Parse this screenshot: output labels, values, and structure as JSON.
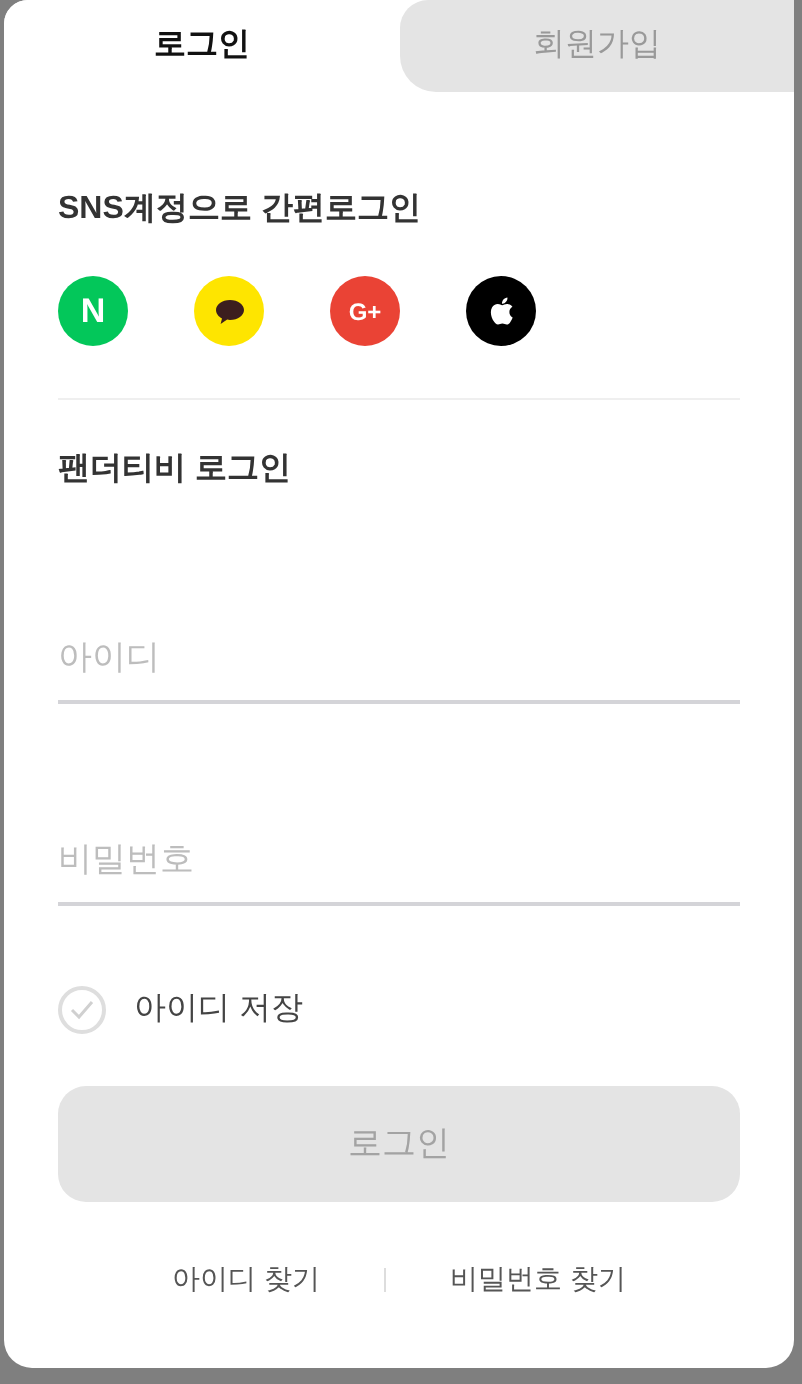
{
  "tabs": [
    {
      "label": "로그인",
      "selected": true
    },
    {
      "label": "회원가입",
      "selected": false
    }
  ],
  "sns": {
    "title": "SNS계정으로 간편로그인",
    "buttons": [
      {
        "kind": "naver",
        "label": "N"
      },
      {
        "kind": "kakao"
      },
      {
        "kind": "google",
        "label": "G+"
      },
      {
        "kind": "apple"
      }
    ]
  },
  "login": {
    "title": "팬더티비 로그인",
    "fields": [
      {
        "placeholder": "아이디"
      },
      {
        "placeholder": "비밀번호"
      }
    ],
    "remember": {
      "label": "아이디 저장",
      "checked": false
    },
    "submit": {
      "label": "로그인",
      "disabled": true
    },
    "links": [
      "아이디 찾기",
      "비밀번호 찾기"
    ]
  }
}
